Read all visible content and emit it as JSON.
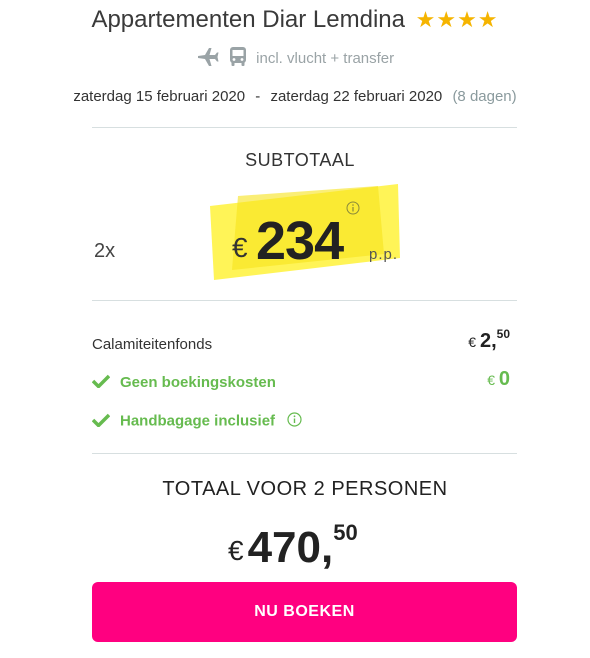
{
  "hotel": {
    "name": "Appartementen Diar Lemdina",
    "stars": "★★★★",
    "transport_text": "incl. vlucht + transfer"
  },
  "trip": {
    "start": "zaterdag 15 februari 2020",
    "separator": "-",
    "end": "zaterdag 22 februari 2020",
    "duration": "(8 dagen)"
  },
  "subtotal": {
    "label": "SUBTOTAAL",
    "quantity": "2x",
    "currency": "€",
    "price": "234",
    "per_person": "p.p."
  },
  "costs": {
    "calamity_label": "Calamiteitenfonds",
    "calamity_currency": "€",
    "calamity_whole": "2,",
    "calamity_cents": "50",
    "booking_label": "Geen boekingskosten",
    "booking_currency": "€",
    "booking_value": "0",
    "baggage_label": "Handbagage inclusief"
  },
  "total": {
    "label": "TOTAAL VOOR 2 PERSONEN",
    "currency": "€",
    "whole": "470,",
    "cents": "50"
  },
  "cta": {
    "label": "NU BOEKEN"
  },
  "colors": {
    "accent": "#ff0080",
    "highlight": "#fff23a",
    "positive": "#66bb4f",
    "star": "#f5b400"
  }
}
